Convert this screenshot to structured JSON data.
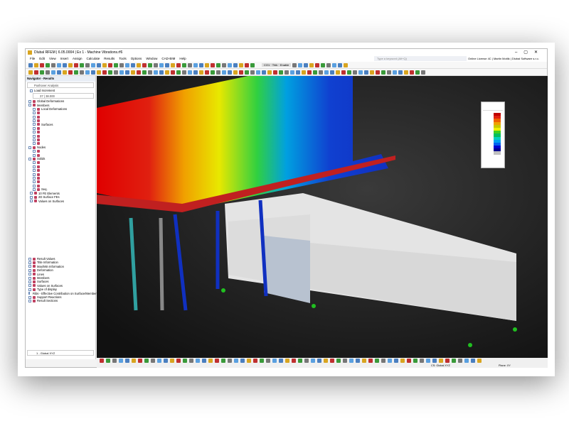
{
  "window": {
    "title": "Dlubal RFEM | 6.05.0004 | Ex 1 - Machine Vibrations.rf6",
    "controls": [
      "–",
      "▢",
      "✕"
    ]
  },
  "menu": [
    "File",
    "Edit",
    "View",
    "Insert",
    "Assign",
    "Calculate",
    "Results",
    "Tools",
    "Options",
    "Window",
    "CAD-BIM",
    "Help"
  ],
  "search": {
    "placeholder": "Type a keyword (Alt+Q)"
  },
  "license": "Online License 4C | Martin Motlik | Dlubal Software s.r.o.",
  "toolbar": {
    "combo": "CO1 · Thik · Enable"
  },
  "navigator": {
    "title": "Navigator - Results",
    "analysis": "Pushover Analysis",
    "load_increment": "Load Increment",
    "increment_value": "37 | 38.000",
    "top_items": [
      "Global Deformations",
      "Members",
      "Local Deformations",
      "",
      "",
      "",
      "Surfaces",
      "",
      "",
      "",
      "",
      "",
      "Nodes",
      "",
      "",
      "Solids",
      "",
      "",
      "",
      "",
      "",
      "",
      "",
      "Seq.",
      "10 FE Elements",
      "2D Surface FEs",
      "Values on Surfaces"
    ],
    "bottom_items": [
      "Result Values",
      "Title Information",
      "Max/Min Information",
      "Deformation",
      "Lines",
      "Members",
      "Surfaces",
      "Values on Surfaces",
      "Type of display",
      "Ribs - Effective Contribution on Surface/Member",
      "Support Reactions",
      "Result Sections"
    ],
    "view_combo": "1 - Global XYZ"
  },
  "status": {
    "cs": "CS: Global XYZ",
    "plane": "Plane: XY"
  },
  "legend": {
    "colors": [
      "#c00000",
      "#e02010",
      "#f06000",
      "#f0a000",
      "#c8c800",
      "#f0f000",
      "#40d020",
      "#00c060",
      "#00d0c0",
      "#00a0f0",
      "#0060f0",
      "#0000d0",
      "#000090",
      "#c0c0c0"
    ]
  }
}
